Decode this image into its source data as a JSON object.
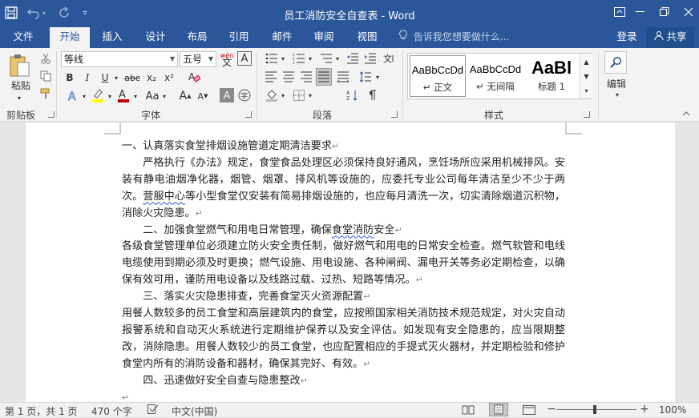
{
  "window": {
    "title": "员工消防安全自查表 - Word"
  },
  "tabs": [
    {
      "label": "文件"
    },
    {
      "label": "开始"
    },
    {
      "label": "插入"
    },
    {
      "label": "设计"
    },
    {
      "label": "布局"
    },
    {
      "label": "引用"
    },
    {
      "label": "邮件"
    },
    {
      "label": "审阅"
    },
    {
      "label": "视图"
    }
  ],
  "tell_me": "告诉我您想要做什么...",
  "account": {
    "login": "登录",
    "share": "共享"
  },
  "ribbon": {
    "clipboard": {
      "paste": "粘贴",
      "group": "剪贴板"
    },
    "font": {
      "name": "等线",
      "size": "五号",
      "wen": "wén",
      "group": "字体",
      "bold": "B",
      "italic": "I",
      "underline": "U",
      "strike": "abc",
      "sub": "x₂",
      "sup": "x²",
      "change_case": "Aa",
      "grow": "A",
      "shrink": "A",
      "shade": "A"
    },
    "paragraph": {
      "group": "段落"
    },
    "styles": {
      "group": "样式",
      "items": [
        {
          "sample": "AaBbCcDd",
          "name": "↵ 正文"
        },
        {
          "sample": "AaBbCcDd",
          "name": "↵ 无间隔"
        },
        {
          "sample": "AaBl",
          "name": "标题 1"
        }
      ]
    },
    "editing": {
      "label": "编辑"
    }
  },
  "document": {
    "paragraphs": [
      "一、认真落实食堂排烟设施管道定期清洁要求",
      "严格执行《办法》规定，食堂食品处理区必须保持良好通风，烹饪场所应采用机械排风。安装有静电油烟净化器，烟管、烟罩、排风机等设施的，应委托专业公司每年清洁至少不少于两次。",
      "营服中心",
      "等小型食堂仅安装有简易排烟设施的，也应每月清洗一次，切实清除烟道沉积物，消除火灾隐患。",
      "二、加强食堂燃气和用电日常管理，确保",
      "食堂消防",
      "安全",
      "各级食堂管理单位必须建立防火安全责任制，做好燃气和用电的日常安全检查。燃气软管和电线电缆使用到期必须及时更换；燃气设施、用电设施、各种闸阀、漏电开关等务必定期检查，以确保有效可用，谨防用电设备以及线路过载、过热、短路等情况。",
      "三、落实火灾隐患排查，完善食堂灭火资源配置",
      "用餐人数较多的员工食堂和高层建筑内的食堂，应按照国家相关消防技术规范规定，对火灾自动报警系统和自动灭火系统进行定期维护保养以及安全评估。如发现有安全隐患的，应当限期整改，消除隐患。用餐人数较少的员工食堂，也应配置相应的手提式灭火器材，并定期检验和修护食堂内所有的消防设备和器材，确保其完好、有效。",
      "四、迅速做好安全自查与隐患整改"
    ],
    "para_mark": "↵"
  },
  "status": {
    "page": "第 1 页，共 1 页",
    "words": "470 个字",
    "language": "中文(中国)",
    "zoom": "100%"
  },
  "colors": {
    "brand": "#2b579a",
    "font_color": "#c00000",
    "highlight": "#ffff00"
  }
}
